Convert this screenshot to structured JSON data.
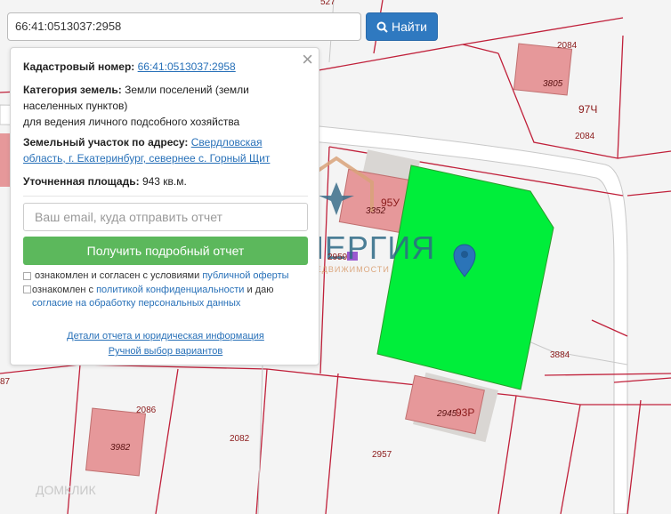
{
  "search": {
    "value": "66:41:0513037:2958",
    "button_label": "Найти"
  },
  "info": {
    "cadastral_label": "Кадастровый номер:",
    "cadastral_value": "66:41:0513037:2958",
    "category_label": "Категория земель:",
    "category_value_1": "Земли поселений (земли",
    "category_value_2": "населенных пунктов)",
    "category_value_3": "для ведения личного подсобного хозяйства",
    "address_label": "Земельный участок по адресу:",
    "address_value_1": "Свердловская",
    "address_value_2": "область, г. Екатеринбург, севернее с. Горный Щит",
    "area_label": "Уточненная площадь:",
    "area_value": "943 кв.м."
  },
  "form": {
    "email_placeholder": "Ваш email, куда отправить отчет",
    "submit_label": "Получить подробный отчет",
    "consent1_text": "ознакомлен и согласен с условиями",
    "consent1_link": "публичной оферты",
    "consent2_text": "ознакомлен с",
    "consent2_link": "политикой конфиденциальности",
    "consent2_text2": "и даю",
    "consent2_link2": "согласие на обработку персональных данных"
  },
  "links": {
    "details": "Детали отчета и юридическая информация",
    "manual": "Ручной выбор вариантов"
  },
  "watermark": {
    "brand": "СИНЕРГИЯ",
    "tagline": "БЮРО НЕДВИЖИМОСТИ",
    "bottom": "ДОМКЛИК"
  },
  "map_labels": {
    "l2084a": "2084",
    "l3805": "3805",
    "l97ch": "97Ч",
    "l2084b": "2084",
    "l3352": "3352",
    "l95u": "95У",
    "l2959": "2959",
    "l3884": "3884",
    "l2945": "2945",
    "l93r": "93Р",
    "l2086": "2086",
    "l3982": "3982",
    "l2082": "2082",
    "l2957": "2957",
    "l527": "527",
    "l87": "87"
  },
  "colors": {
    "selected_parcel": "#00ee3a",
    "building": "#e6989a",
    "boundary": "#c0203a",
    "accent": "#2f79c0",
    "submit": "#5cb85c"
  }
}
